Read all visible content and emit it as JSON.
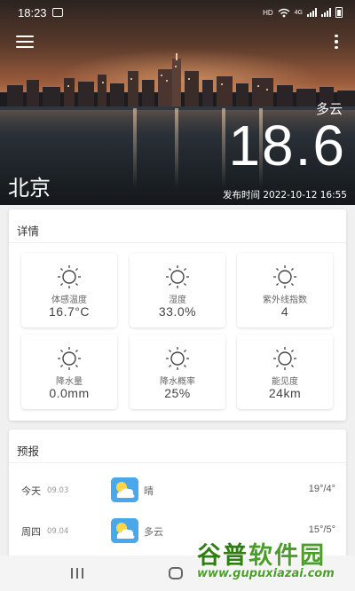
{
  "status_bar": {
    "time": "18:23",
    "network": "HD",
    "signal": "4G"
  },
  "hero": {
    "condition": "多云",
    "temperature": "18.6",
    "city": "北京",
    "published": "发布时间 2022-10-12 16:55"
  },
  "details": {
    "title": "详情",
    "items": [
      {
        "label": "体感温度",
        "value": "16.7°C",
        "icon": "sun-icon"
      },
      {
        "label": "湿度",
        "value": "33.0%",
        "icon": "sun-icon"
      },
      {
        "label": "紫外线指数",
        "value": "4",
        "icon": "sun-icon"
      },
      {
        "label": "降水量",
        "value": "0.0mm",
        "icon": "sun-icon"
      },
      {
        "label": "降水概率",
        "value": "25%",
        "icon": "sun-icon"
      },
      {
        "label": "能见度",
        "value": "24km",
        "icon": "sun-icon"
      }
    ]
  },
  "forecast": {
    "title": "预报",
    "days": [
      {
        "day": "今天",
        "date": "09.03",
        "text": "晴",
        "range": "19°/4°",
        "icon": "partly-cloudy-icon"
      },
      {
        "day": "周四",
        "date": "09.04",
        "text": "多云",
        "range": "15°/5°",
        "icon": "partly-cloudy-icon"
      }
    ]
  },
  "watermark": {
    "title_a": "谷普",
    "title_b": "软件园",
    "url": "www.gupuxiazai.com"
  },
  "colors": {
    "accent_icon": "#4aa8ea",
    "watermark": "#4c9e2a"
  }
}
